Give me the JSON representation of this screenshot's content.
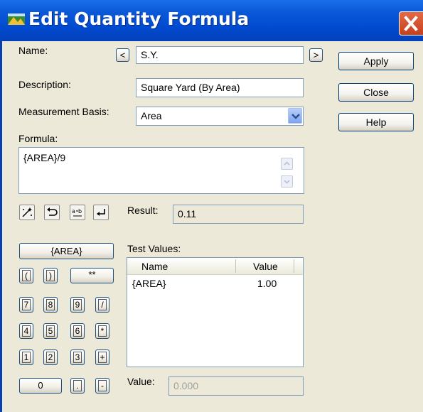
{
  "window": {
    "title": "Edit Quantity Formula"
  },
  "form": {
    "name_label": "Name:",
    "name_value": "S.Y.",
    "prev_label": "<",
    "next_label": ">",
    "description_label": "Description:",
    "description_value": "Square Yard (By Area)",
    "basis_label": "Measurement Basis:",
    "basis_value": "Area",
    "formula_label": "Formula:",
    "formula_value": "{AREA}/9",
    "result_label": "Result:",
    "result_value": "0.11",
    "test_values_label": "Test Values:",
    "value_label": "Value:",
    "value_value": "0.000"
  },
  "buttons": {
    "apply": "Apply",
    "close": "Close",
    "help": "Help"
  },
  "area_button": "{AREA}",
  "keypad": {
    "open_paren": "(",
    "close_paren": ")",
    "power": "**",
    "k7": "7",
    "k8": "8",
    "k9": "9",
    "divide": "/",
    "k4": "4",
    "k5": "5",
    "k6": "6",
    "multiply": "*",
    "k1": "1",
    "k2": "2",
    "k3": "3",
    "plus": "+",
    "k0": "0",
    "dot": ".",
    "minus": "-"
  },
  "test_table": {
    "headers": [
      "Name",
      "Value"
    ],
    "rows": [
      {
        "name": "{AREA}",
        "value": "1.00"
      }
    ]
  },
  "icons": {
    "app": "app-icon",
    "close": "close-icon",
    "wand": "wand-icon",
    "undo": "undo-icon",
    "rename": "rename-icon",
    "enter": "enter-icon"
  }
}
